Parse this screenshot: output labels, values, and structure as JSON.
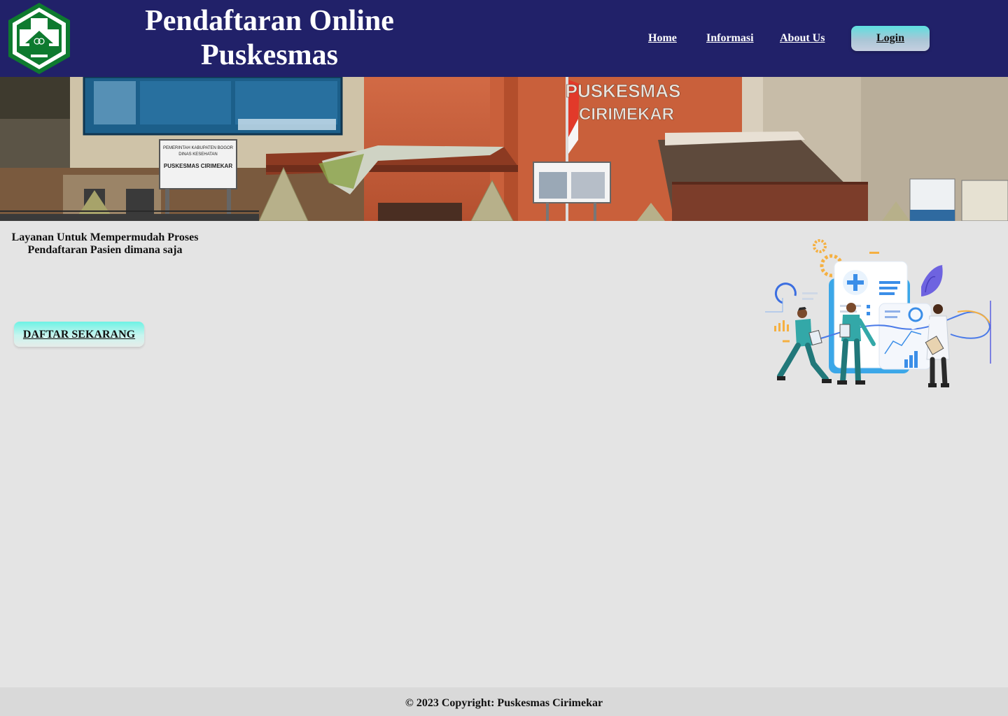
{
  "header": {
    "title_line1": "Pendaftaran Online",
    "title_line2": "Puskesmas",
    "logo_icon": "puskesmas-cross-logo",
    "nav": {
      "home": "Home",
      "info": "Informasi",
      "about": "About Us"
    },
    "login_label": "Login"
  },
  "banner": {
    "sign_text_line1": "PUSKESMAS",
    "sign_text_line2": "CIRIMEKAR",
    "board_lines": [
      "PEMERINTAH KABUPATEN BOGOR",
      "DINAS KESEHATAN",
      "PUSKESMAS CIRIMEKAR"
    ]
  },
  "hero": {
    "tagline": "Layanan Untuk Mempermudah Proses Pendaftaran Pasien dimana saja",
    "cta_label": "DAFTAR SEKARANG",
    "illustration_icon": "medical-team-illustration"
  },
  "footer": {
    "copyright": "© 2023 Copyright: Puskesmas Cirimekar"
  },
  "colors": {
    "navbar": "#212169",
    "page_bg": "#e4e4e4",
    "footer_bg": "#d9d9d9",
    "logo_green": "#0e7a2f"
  }
}
